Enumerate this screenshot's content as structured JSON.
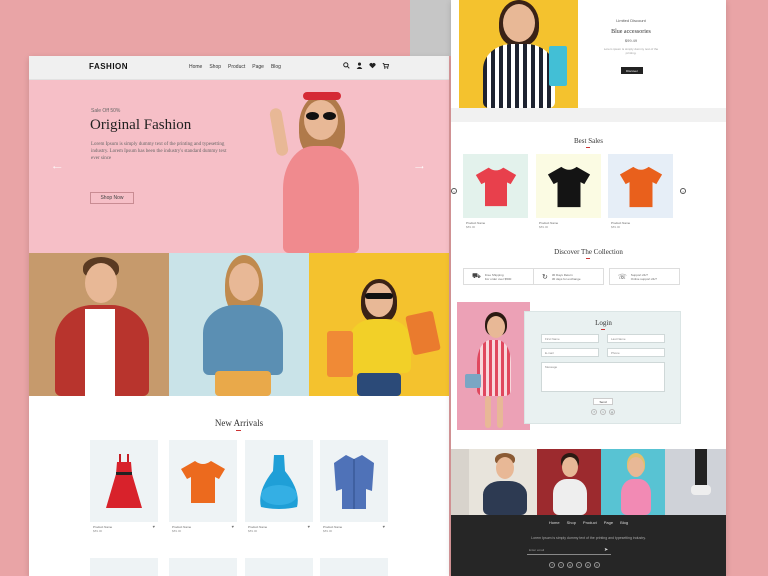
{
  "brand": "FASHION",
  "nav": [
    "Home",
    "Shop",
    "Product",
    "Page",
    "Blog"
  ],
  "icons": {
    "search": "⌕",
    "user": "👤",
    "heart": "♥",
    "cart": "🛒"
  },
  "hero": {
    "sale": "Sale Off 50%",
    "title": "Original Fashion",
    "text": "Lorem Ipsum is simply dummy text of the printing and typesetting industry. Lorem Ipsum has been the industry's standard dummy text ever since",
    "button": "Shop Now"
  },
  "new_arrivals": {
    "title": "New Arrivals",
    "products": [
      {
        "name": "Product Name",
        "price": "$89.00"
      },
      {
        "name": "Product Name",
        "price": "$89.00"
      },
      {
        "name": "Product Name",
        "price": "$89.00"
      },
      {
        "name": "Product Name",
        "price": "$89.00"
      }
    ]
  },
  "offer": {
    "label": "Limited Discount",
    "title": "Blue accessories",
    "price": "$99.49",
    "text": "Lorem ipsum is simply dummy text of the printing.",
    "button": "Discover"
  },
  "best_sales": {
    "title": "Best Sales",
    "products": [
      {
        "name": "Product Name",
        "price": "$89.00"
      },
      {
        "name": "Product Name",
        "price": "$89.00"
      },
      {
        "name": "Product Name",
        "price": "$89.00"
      }
    ]
  },
  "collection": {
    "title": "Discover The Collection",
    "features": [
      {
        "title": "Free Shipping",
        "sub": "For order over $500"
      },
      {
        "title": "30 Days Return",
        "sub": "30 days for exchange"
      },
      {
        "title": "Support 24/7",
        "sub": "Online support 24/7"
      }
    ]
  },
  "login": {
    "title": "Login",
    "first_name": "First Name",
    "last_name": "Last Name",
    "email": "E-mail",
    "phone": "Phone",
    "message": "Message",
    "submit": "Send"
  },
  "footer": {
    "links": [
      "Home",
      "Shop",
      "Product",
      "Page",
      "Blog"
    ],
    "text": "Lorem Ipsum is simply dummy text of the printing and typesetting industry.",
    "email_placeholder": "Enter email",
    "social": [
      "f",
      "t",
      "g",
      "i",
      "p",
      "y"
    ]
  },
  "colors": {
    "accent": "#c33333",
    "hero_bg": "#f6bfc7",
    "yellow": "#f4c22e"
  }
}
